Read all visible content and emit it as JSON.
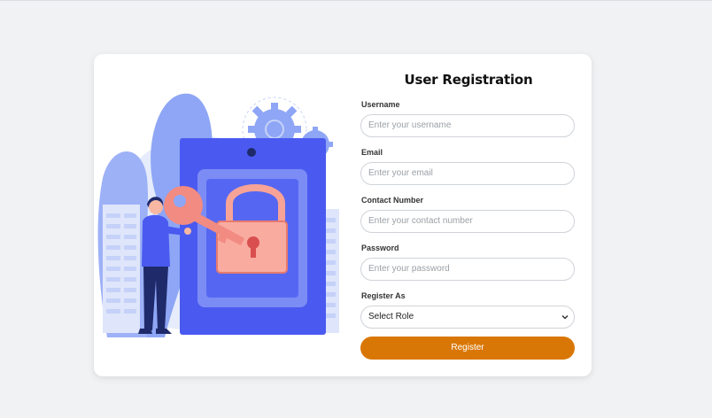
{
  "form": {
    "title": "User Registration",
    "username": {
      "label": "Username",
      "placeholder": "Enter your username"
    },
    "email": {
      "label": "Email",
      "placeholder": "Enter your email"
    },
    "contact": {
      "label": "Contact Number",
      "placeholder": "Enter your contact number"
    },
    "password": {
      "label": "Password",
      "placeholder": "Enter your password"
    },
    "role": {
      "label": "Register As",
      "selected": "Select Role"
    },
    "submit_label": "Register"
  },
  "colors": {
    "accent": "#d97706",
    "illustration_blue": "#4a5af0",
    "illustration_salmon": "#f28b82"
  },
  "icons": [
    "padlock-icon",
    "key-icon",
    "gear-icon",
    "chevron-down-icon"
  ]
}
